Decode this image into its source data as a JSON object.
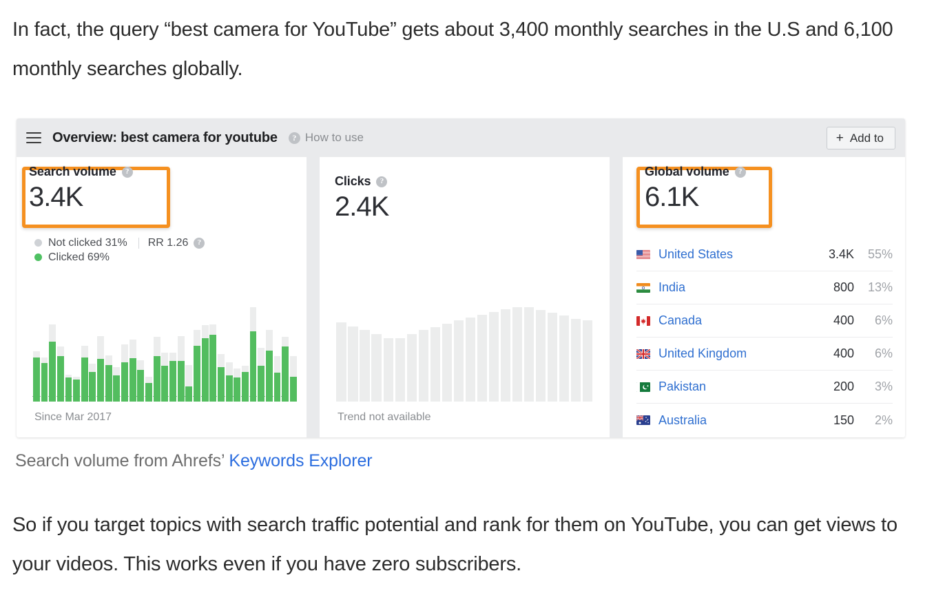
{
  "article": {
    "paragraph_top": "In fact, the query “best camera for YouTube” gets about 3,400 monthly searches in the U.S and 6,100 monthly searches globally.",
    "caption_prefix": "Search volume from Ahrefs’ ",
    "caption_link": "Keywords Explorer",
    "paragraph_bottom": "So if you target topics with search traffic potential and rank for them on YouTube, you can get views to your videos. This works even if you have zero subscribers."
  },
  "widget": {
    "menu_icon": "hamburger-icon",
    "title": "Overview: best camera for youtube",
    "how_to_use": "How to use",
    "help_glyph": "?",
    "add_to": {
      "plus": "+",
      "label": "Add to"
    },
    "accent_highlight": "#f59020",
    "link_color": "#2f6fd0",
    "green": "#53bd5f",
    "grey_bar": "#e9eaec"
  },
  "search_volume": {
    "label": "Search volume",
    "value": "3.4K",
    "not_clicked": "Not clicked 31%",
    "clicked": "Clicked 69%",
    "rr": "RR 1.26",
    "footer": "Since Mar 2017"
  },
  "clicks": {
    "label": "Clicks",
    "value": "2.4K",
    "footer": "Trend not available"
  },
  "global_volume": {
    "label": "Global volume",
    "value": "6.1K",
    "countries": [
      {
        "flag": "us",
        "name": "United States",
        "volume": "3.4K",
        "percent": "55%"
      },
      {
        "flag": "in",
        "name": "India",
        "volume": "800",
        "percent": "13%"
      },
      {
        "flag": "ca",
        "name": "Canada",
        "volume": "400",
        "percent": "6%"
      },
      {
        "flag": "gb",
        "name": "United Kingdom",
        "volume": "400",
        "percent": "6%"
      },
      {
        "flag": "pk",
        "name": "Pakistan",
        "volume": "200",
        "percent": "3%"
      },
      {
        "flag": "au",
        "name": "Australia",
        "volume": "150",
        "percent": "2%"
      }
    ]
  },
  "chart_data": [
    {
      "type": "bar",
      "name": "search-volume-trend",
      "title": "Search volume",
      "xlabel": "",
      "ylabel": "",
      "footer": "Since Mar 2017",
      "stacked": true,
      "average_line": 62,
      "ylim": [
        0,
        100
      ],
      "series": [
        {
          "name": "Clicked",
          "color": "#53bd5f",
          "values": [
            46,
            40,
            62,
            47,
            25,
            23,
            46,
            31,
            44,
            38,
            27,
            41,
            45,
            33,
            19,
            47,
            37,
            42,
            42,
            16,
            58,
            66,
            69,
            36,
            27,
            25,
            31,
            73,
            37,
            53,
            30,
            57,
            26
          ]
        },
        {
          "name": "Not clicked",
          "color": "#eceded",
          "values": [
            52,
            46,
            80,
            57,
            28,
            26,
            58,
            39,
            68,
            48,
            36,
            59,
            64,
            43,
            26,
            67,
            51,
            51,
            68,
            38,
            74,
            79,
            80,
            49,
            41,
            34,
            37,
            98,
            56,
            74,
            47,
            67,
            47
          ]
        }
      ]
    },
    {
      "type": "bar",
      "name": "clicks-trend",
      "title": "Clicks",
      "xlabel": "",
      "ylabel": "",
      "footer": "Trend not available",
      "color": "#eceded",
      "ylim": [
        0,
        100
      ],
      "values": [
        82,
        78,
        74,
        70,
        66,
        66,
        70,
        74,
        77,
        81,
        84,
        87,
        90,
        93,
        96,
        98,
        98,
        95,
        92,
        89,
        86,
        84
      ]
    }
  ]
}
